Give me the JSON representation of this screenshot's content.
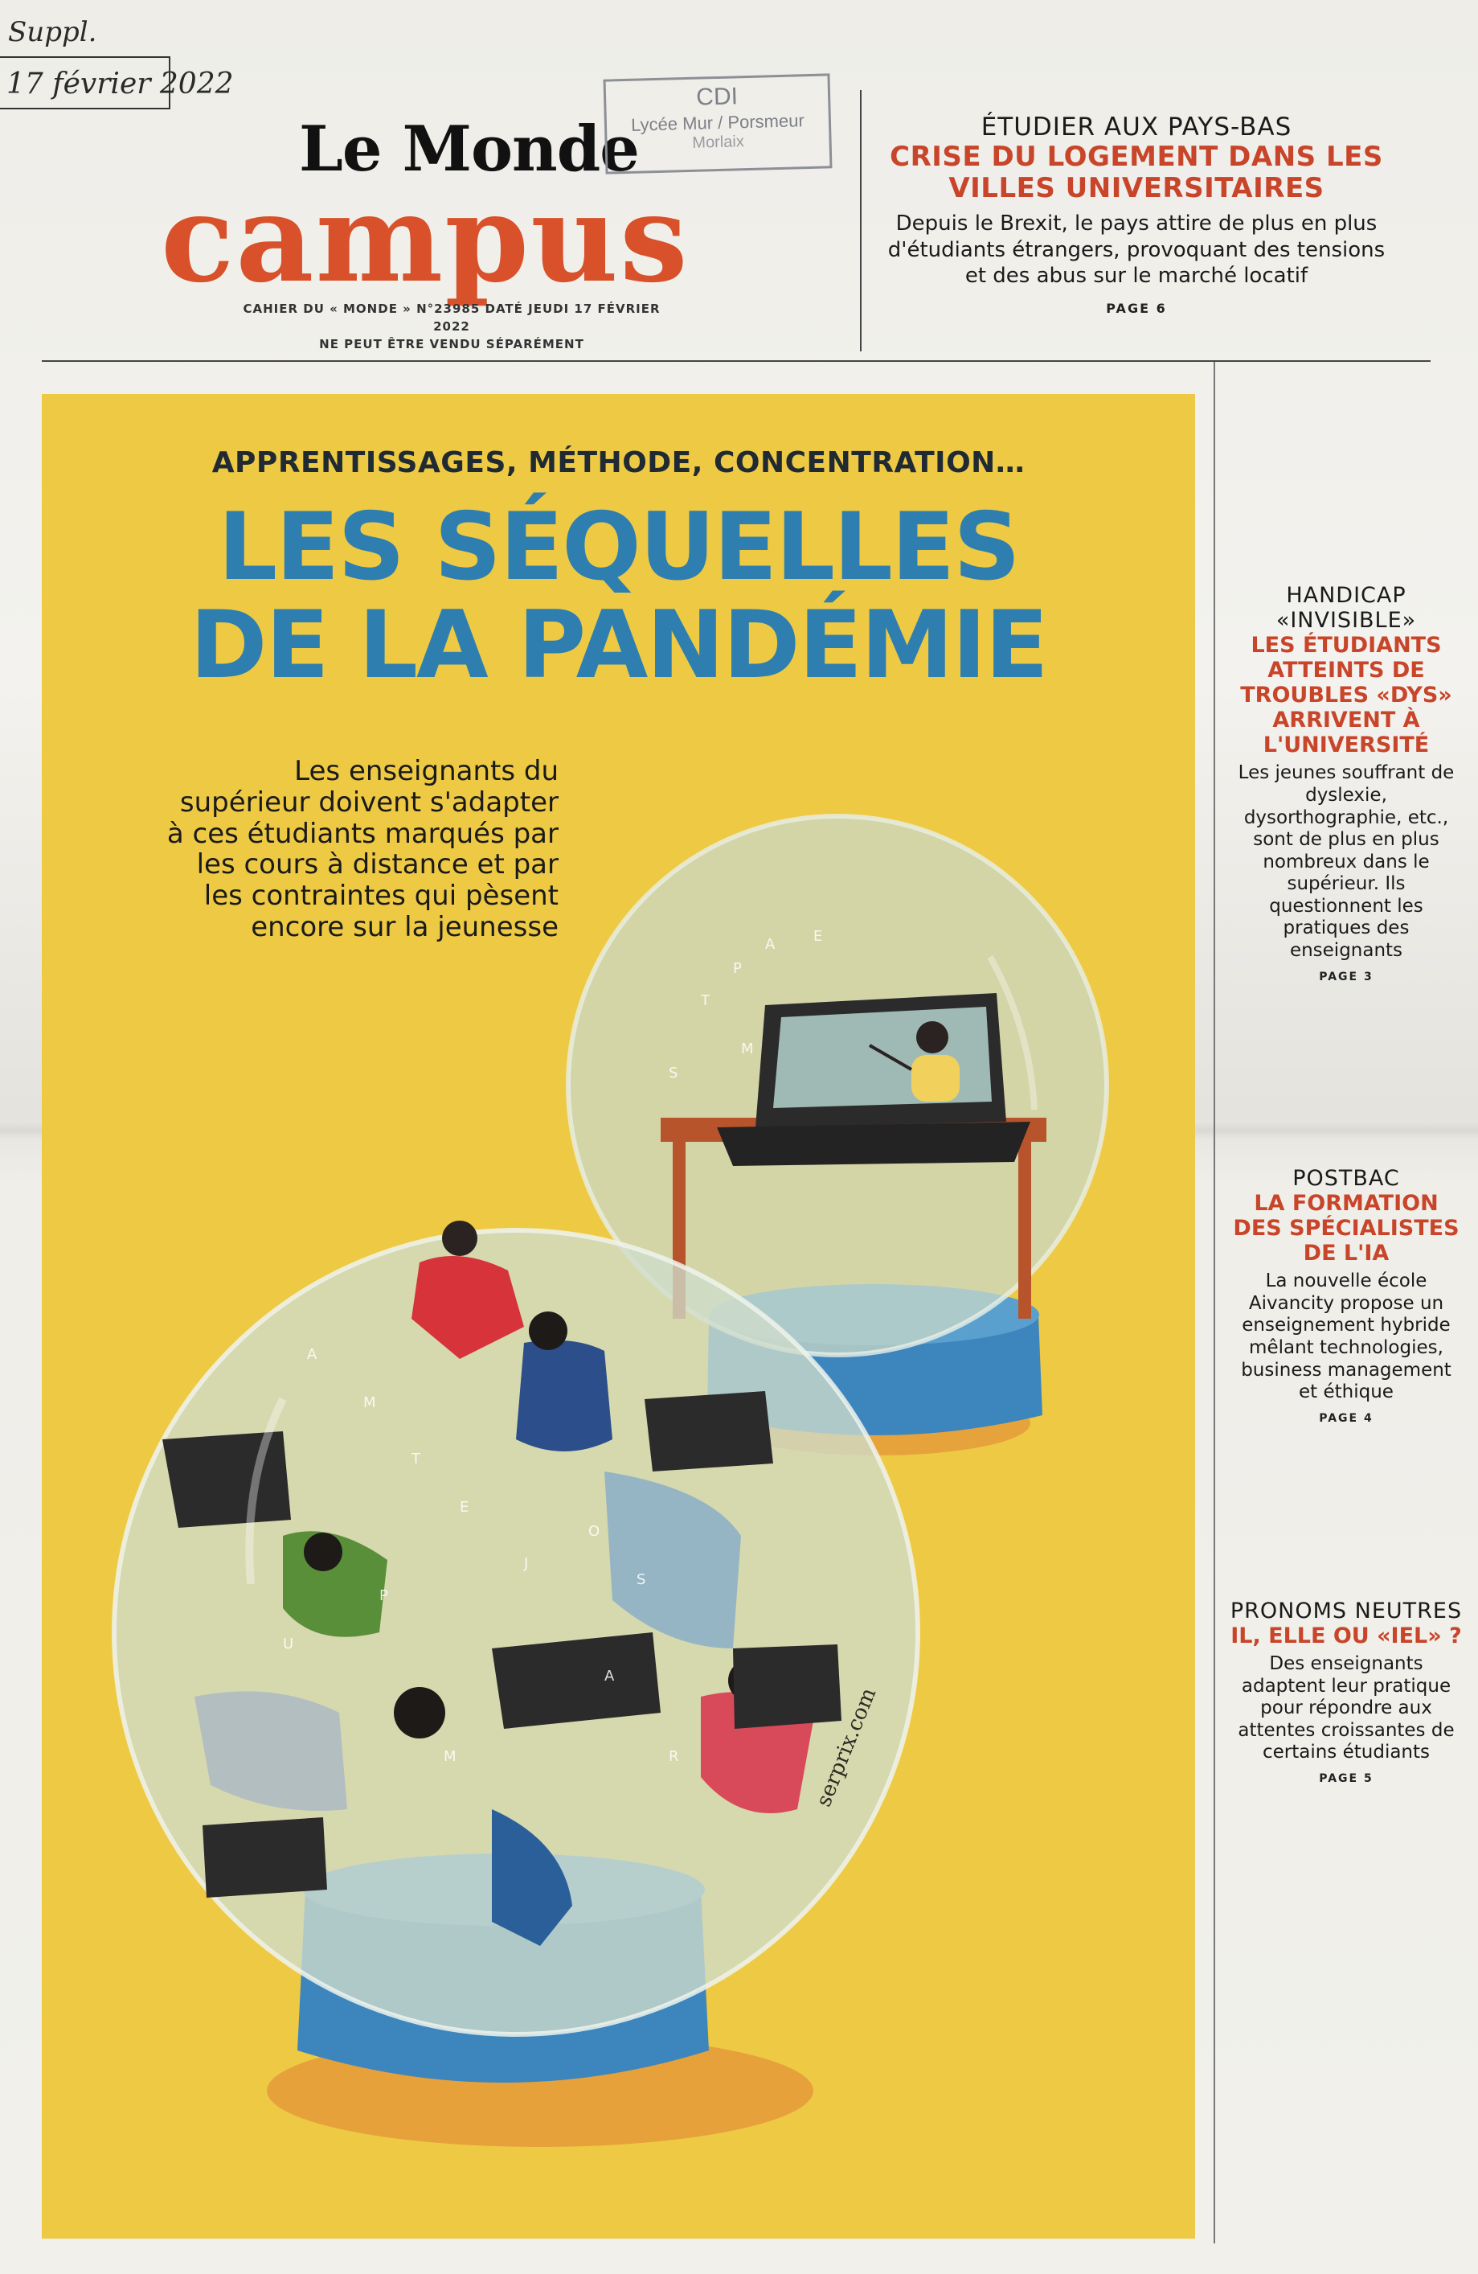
{
  "handwriting": {
    "line1": "Suppl.",
    "line2": "17 février 2022"
  },
  "masthead": {
    "logo_top": "Le Monde",
    "logo_bottom": "campus",
    "issue_line1": "CAHIER DU « MONDE » N°23985 DATÉ JEUDI 17 FÉVRIER 2022",
    "issue_line2": "NE PEUT ÊTRE VENDU SÉPARÉMENT"
  },
  "stamp": {
    "line1": "CDI",
    "line2": "Lycée Mur / Porsmeur",
    "line3": "Morlaix"
  },
  "top_teaser": {
    "kicker": "ÉTUDIER AUX PAYS-BAS",
    "headline": "CRISE DU LOGEMENT DANS LES VILLES UNIVERSITAIRES",
    "deck": "Depuis le Brexit, le pays attire de plus en plus d'étudiants étrangers, provoquant des tensions et des abus sur le marché locatif",
    "page": "PAGE 6"
  },
  "cover": {
    "supra": "APPRENTISSAGES, MÉTHODE, CONCENTRATION…",
    "headline_line1": "LES SÉQUELLES",
    "headline_line2": "DE LA PANDÉMIE",
    "lede": "Les enseignants du supérieur doivent s'adapter à ces étudiants marqués par les cours à distance et par les contraintes qui pèsent encore sur la jeunesse",
    "illustration_credit": "serprix.com"
  },
  "sidebar": [
    {
      "kicker": "HANDICAP «INVISIBLE»",
      "headline": "LES ÉTUDIANTS ATTEINTS DE TROUBLES «DYS» ARRIVENT À L'UNIVERSITÉ",
      "deck": "Les jeunes souffrant de dyslexie, dysorthographie, etc., sont de plus en plus nombreux dans le supérieur. Ils questionnent les pratiques des enseignants",
      "page": "PAGE 3"
    },
    {
      "kicker": "POSTBAC",
      "headline": "LA FORMATION DES SPÉCIALISTES DE L'IA",
      "deck": "La nouvelle école Aivancity propose un enseignement hybride mêlant technologies, business management et éthique",
      "page": "PAGE 4"
    },
    {
      "kicker": "PRONOMS NEUTRES",
      "headline": "IL, ELLE OU «IEL» ?",
      "deck": "Des enseignants adaptent leur pratique pour répondre aux attentes croissantes de certains étudiants",
      "page": "PAGE 5"
    }
  ],
  "colors": {
    "campus_orange": "#d8512a",
    "headline_blue": "#2e7fb0",
    "teaser_red": "#c8452a",
    "cover_yellow": "#eec944"
  },
  "icons": [
    "snow-globe-illustration",
    "laptop-icon",
    "teacher-figure",
    "falling-students-figures"
  ]
}
